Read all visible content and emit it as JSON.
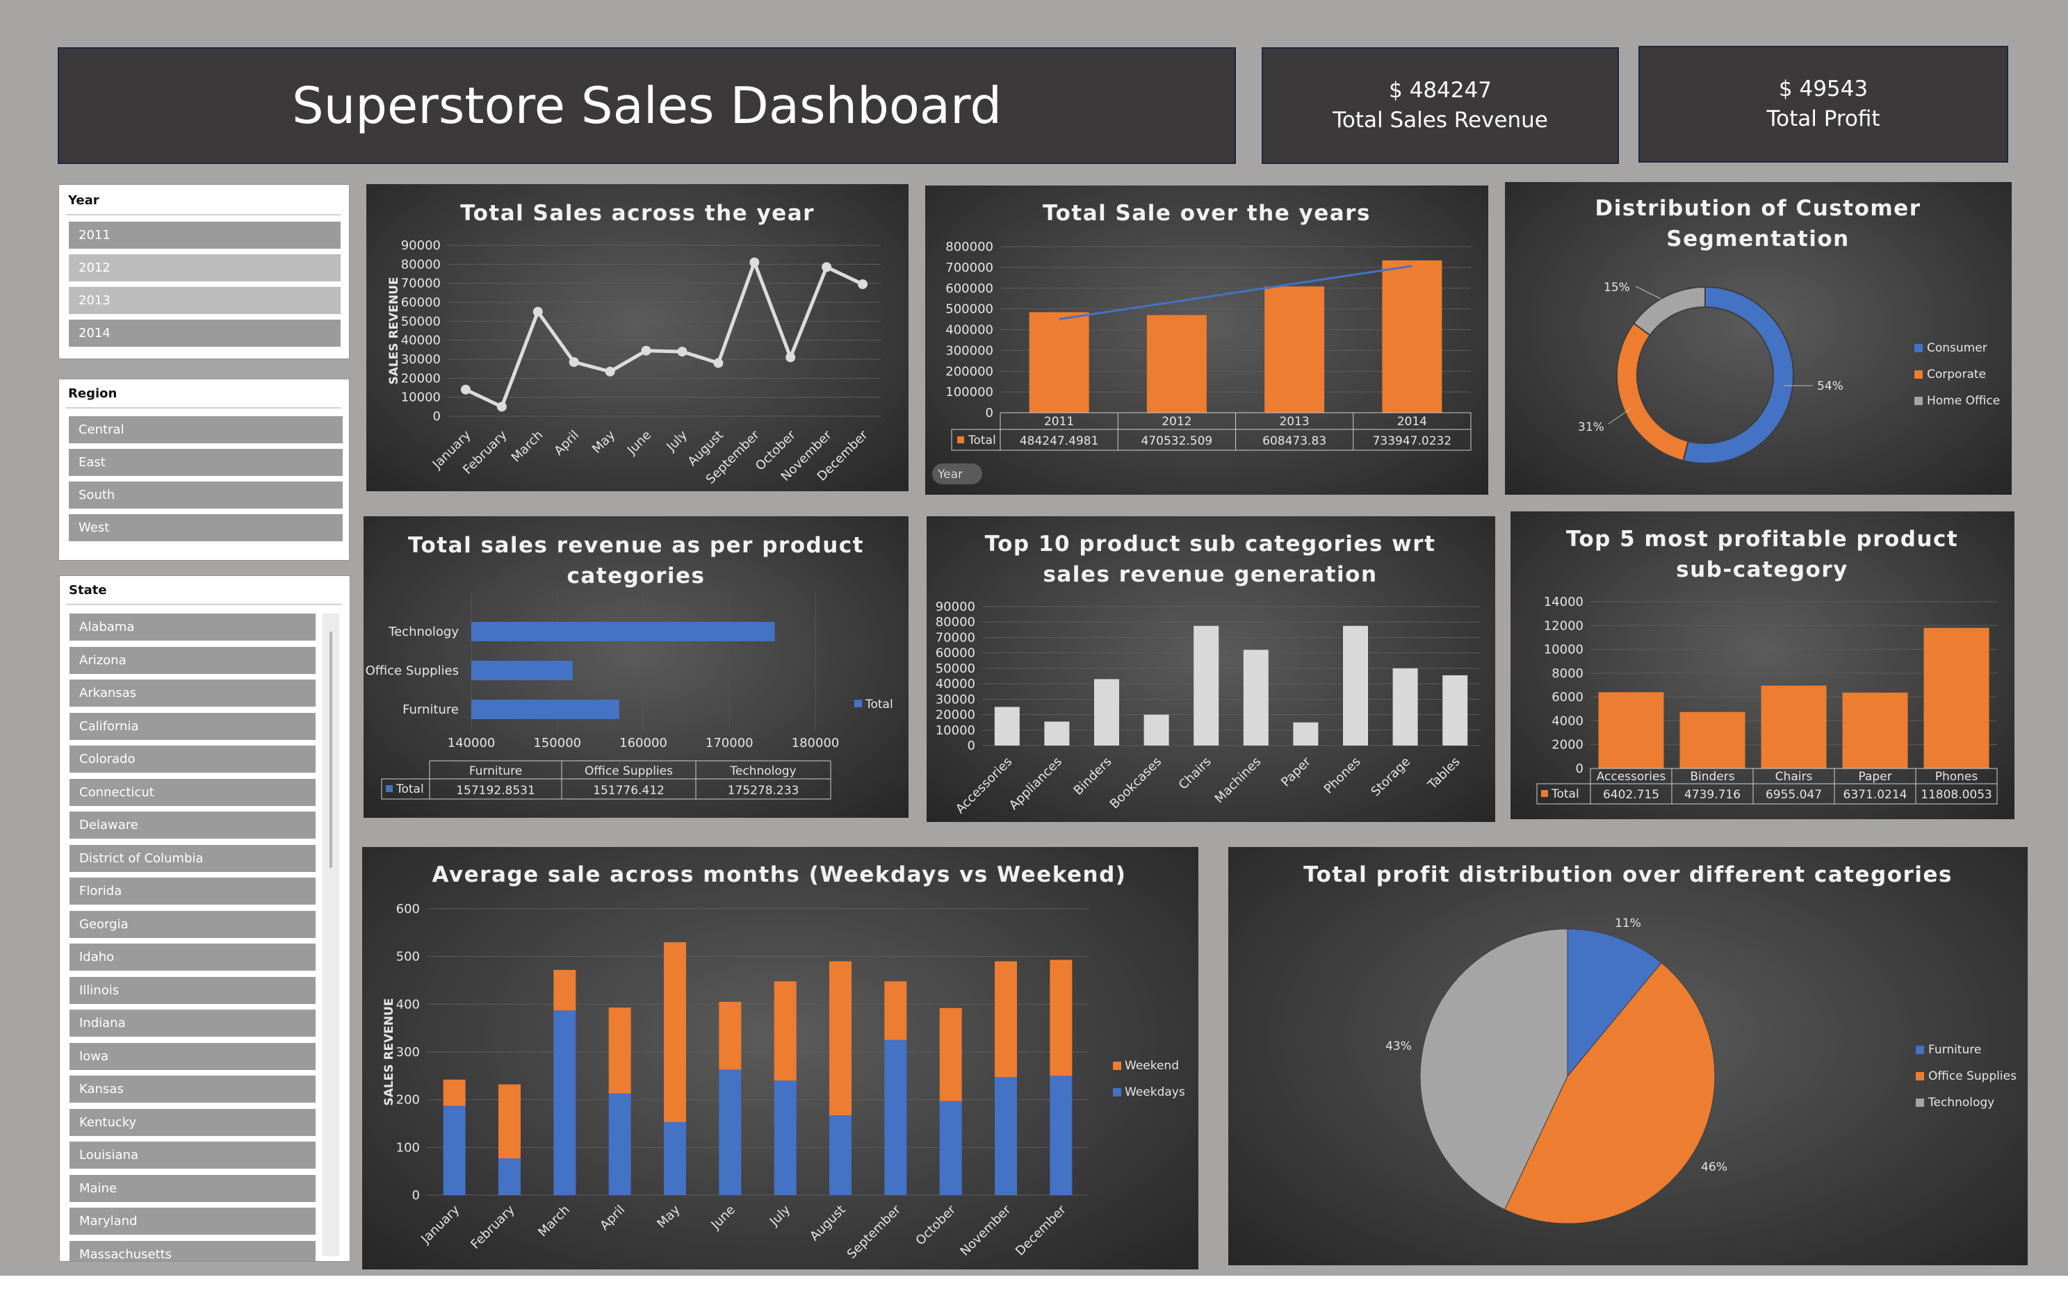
{
  "header": {
    "title": "Superstore Sales Dashboard"
  },
  "kpis": {
    "sales": {
      "value": "$ 484247",
      "label": "Total Sales Revenue"
    },
    "profit": {
      "value": "$ 49543",
      "label": "Total Profit"
    }
  },
  "slicers": {
    "year": {
      "title": "Year",
      "items": [
        "2011",
        "2012",
        "2013",
        "2014"
      ]
    },
    "region": {
      "title": "Region",
      "items": [
        "Central",
        "East",
        "South",
        "West"
      ]
    },
    "state": {
      "title": "State",
      "items": [
        "Alabama",
        "Arizona",
        "Arkansas",
        "California",
        "Colorado",
        "Connecticut",
        "Delaware",
        "District of Columbia",
        "Florida",
        "Georgia",
        "Idaho",
        "Illinois",
        "Indiana",
        "Iowa",
        "Kansas",
        "Kentucky",
        "Louisiana",
        "Maine",
        "Maryland",
        "Massachusetts"
      ]
    }
  },
  "colors": {
    "orange": "#ed7d31",
    "blue": "#4472c4",
    "gray": "#a5a5a5",
    "light": "#d9d9d9"
  },
  "chart_data": [
    {
      "id": "monthly",
      "type": "line",
      "title": "Total Sales across the year",
      "ylabel": "SALES REVENUE",
      "categories": [
        "January",
        "February",
        "March",
        "April",
        "May",
        "June",
        "July",
        "August",
        "September",
        "October",
        "November",
        "December"
      ],
      "values": [
        14000,
        5000,
        55000,
        28500,
        23500,
        34500,
        34000,
        28000,
        81000,
        31000,
        78500,
        69500
      ],
      "ylim": [
        0,
        90000
      ],
      "yticks": [
        0,
        10000,
        20000,
        30000,
        40000,
        50000,
        60000,
        70000,
        80000,
        90000
      ]
    },
    {
      "id": "years",
      "type": "bar",
      "title": "Total Sale over the years",
      "categories": [
        "2011",
        "2012",
        "2013",
        "2014"
      ],
      "values": [
        484247.4981,
        470532.509,
        608473.83,
        733947.0232
      ],
      "value_labels": [
        "484247.4981",
        "470532.509",
        "608473.83",
        "733947.0232"
      ],
      "series_name": "Total",
      "axis_field": "Year",
      "ylim": [
        0,
        800000
      ],
      "yticks": [
        0,
        100000,
        200000,
        300000,
        400000,
        500000,
        600000,
        700000,
        800000
      ],
      "trendline": true
    },
    {
      "id": "segment",
      "type": "pie",
      "title": "Distribution of Customer Segmentation",
      "categories": [
        "Consumer",
        "Corporate",
        "Home Office"
      ],
      "values": [
        54,
        31,
        15
      ],
      "labels": [
        "54%",
        "31%",
        "15%"
      ]
    },
    {
      "id": "category",
      "type": "bar",
      "title": "Total sales revenue as per product categories",
      "categories": [
        "Furniture",
        "Office Supplies",
        "Technology"
      ],
      "values": [
        157192.8531,
        151776.412,
        175278.233
      ],
      "value_labels": [
        "157192.8531",
        "151776.412",
        "175278.233"
      ],
      "series_name": "Total",
      "xlim": [
        140000,
        180000
      ],
      "xticks": [
        140000,
        150000,
        160000,
        170000,
        180000
      ]
    },
    {
      "id": "subcat",
      "type": "bar",
      "title": "Top 10 product sub categories wrt sales revenue generation",
      "categories": [
        "Accessories",
        "Appliances",
        "Binders",
        "Bookcases",
        "Chairs",
        "Machines",
        "Paper",
        "Phones",
        "Storage",
        "Tables"
      ],
      "values": [
        25000,
        15500,
        43000,
        20000,
        77500,
        62000,
        15000,
        77500,
        50000,
        45500
      ],
      "ylim": [
        0,
        90000
      ],
      "yticks": [
        0,
        10000,
        20000,
        30000,
        40000,
        50000,
        60000,
        70000,
        80000,
        90000
      ]
    },
    {
      "id": "profit5",
      "type": "bar",
      "title": "Top 5 most profitable product sub-category",
      "categories": [
        "Accessories",
        "Binders",
        "Chairs",
        "Paper",
        "Phones"
      ],
      "values": [
        6402.715,
        4739.716,
        6955.047,
        6371.0214,
        11808.0053
      ],
      "value_labels": [
        "6402.715",
        "4739.716",
        "6955.047",
        "6371.0214",
        "11808.0053"
      ],
      "series_name": "Total",
      "ylim": [
        0,
        14000
      ],
      "yticks": [
        0,
        2000,
        4000,
        6000,
        8000,
        10000,
        12000,
        14000
      ]
    },
    {
      "id": "weekly",
      "type": "bar",
      "title": "Average sale across months (Weekdays vs Weekend)",
      "ylabel": "SALES REVENUE",
      "categories": [
        "January",
        "February",
        "March",
        "April",
        "May",
        "June",
        "July",
        "August",
        "September",
        "October",
        "November",
        "December"
      ],
      "series": [
        {
          "name": "Weekdays",
          "values": [
            187,
            77,
            387,
            213,
            153,
            263,
            240,
            167,
            325,
            197,
            247,
            250
          ]
        },
        {
          "name": "Weekend",
          "values": [
            55,
            155,
            85,
            180,
            377,
            142,
            208,
            323,
            123,
            195,
            243,
            243
          ]
        }
      ],
      "ylim": [
        0,
        600
      ],
      "yticks": [
        0,
        100,
        200,
        300,
        400,
        500,
        600
      ]
    },
    {
      "id": "profitpie",
      "type": "pie",
      "title": "Total profit distribution over different categories",
      "categories": [
        "Furniture",
        "Office Supplies",
        "Technology"
      ],
      "values": [
        11,
        46,
        43
      ],
      "labels": [
        "11%",
        "46%",
        "43%"
      ]
    }
  ]
}
